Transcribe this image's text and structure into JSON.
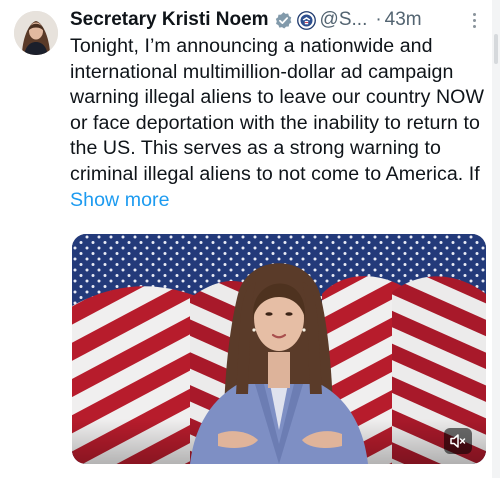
{
  "tweet": {
    "author": {
      "display_name": "Secretary Kristi Noem",
      "handle": "@S...",
      "verified_icon": "gray-check-badge-icon",
      "seal_icon": "dhs-seal-icon"
    },
    "separator": "·",
    "timestamp": "43m",
    "body": "Tonight, I’m announcing a nationwide and international multimillion-dollar ad campaign warning illegal aliens to leave our country NOW or face deportation with the inability to return to the US. This serves as a strong warning to criminal illegal aliens to not come to America. If ",
    "show_more_label": "Show more",
    "media": {
      "type": "video",
      "mute_icon": "muted-speaker-icon"
    }
  },
  "colors": {
    "link": "#1d9bf0",
    "secondary_text": "#536471",
    "primary_text": "#0f1419",
    "badge": "#829aab"
  }
}
